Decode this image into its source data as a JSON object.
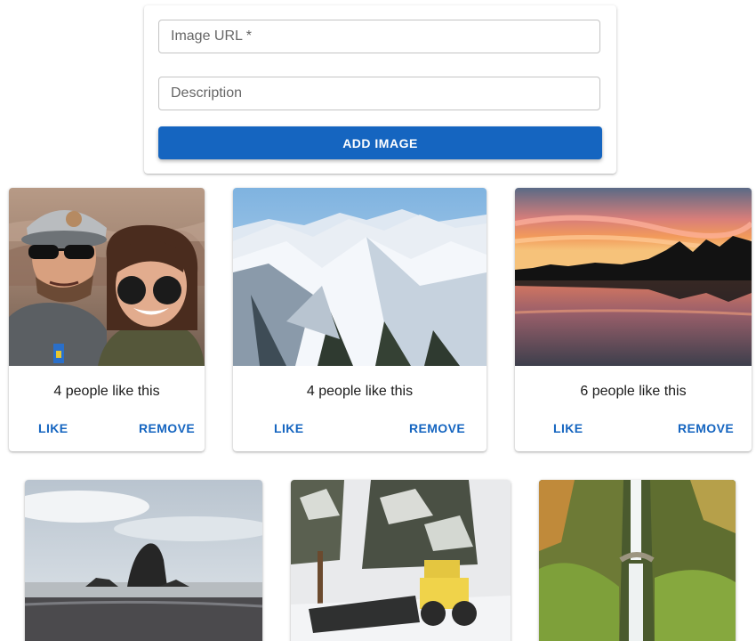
{
  "form": {
    "url_placeholder": "Image URL *",
    "description_placeholder": "Description",
    "submit_label": "ADD IMAGE"
  },
  "cards": [
    {
      "photo": "couple-selfie-canyon",
      "likes_text": "4 people like this",
      "like_label": "LIKE",
      "remove_label": "REMOVE"
    },
    {
      "photo": "snowy-mountains",
      "likes_text": "4 people like this",
      "like_label": "LIKE",
      "remove_label": "REMOVE"
    },
    {
      "photo": "sunset-lake",
      "likes_text": "6 people like this",
      "like_label": "LIKE",
      "remove_label": "REMOVE"
    },
    {
      "photo": "haystack-rock-beach"
    },
    {
      "photo": "snowplow-forest"
    },
    {
      "photo": "multnomah-falls"
    }
  ],
  "colors": {
    "primary": "#1565c0",
    "card_bg": "#ffffff"
  }
}
